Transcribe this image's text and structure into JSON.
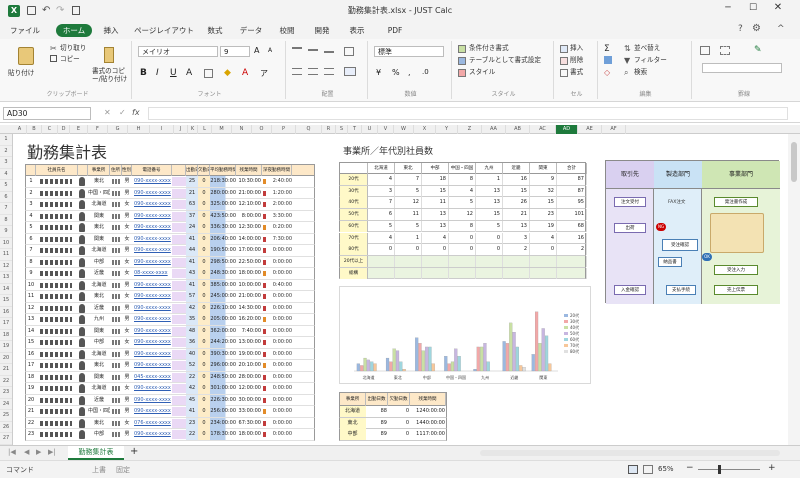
{
  "app": {
    "title": "勤務集計表.xlsx - JUST Calc",
    "brand_color": "#1e7a3c"
  },
  "qat": {
    "icons": [
      "app-logo-icon",
      "save-icon",
      "undo-icon",
      "redo-icon",
      "paste-icon"
    ]
  },
  "tabs": [
    "ファイル",
    "ホーム",
    "挿入",
    "ページレイアウト",
    "数式",
    "データ",
    "校閲",
    "開発",
    "表示",
    "PDF"
  ],
  "ribbon": {
    "clipboard": {
      "paste": "貼り付け",
      "cut": "切り取り",
      "copy": "コピー",
      "format_painter": "書式のコピー/貼り付け",
      "label": "クリップボード"
    },
    "font": {
      "name": "メイリオ",
      "size": "9",
      "label": "フォント"
    },
    "alignment": {
      "label": "配置"
    },
    "number": {
      "format": "標準",
      "label": "数値"
    },
    "styles": {
      "conditional": "条件付き書式",
      "as_table": "テーブルとして書式設定",
      "cell_styles": "スタイル",
      "label": "スタイル"
    },
    "cells": {
      "insert": "挿入",
      "delete": "削除",
      "format": "書式",
      "label": "セル"
    },
    "editing": {
      "sort": "並べ替え",
      "filter": "フィルター",
      "find": "検索",
      "label": "編集"
    },
    "drawing": {
      "label": "罫線"
    }
  },
  "formula_bar": {
    "name_box": "AD30",
    "fx": "fx",
    "value": ""
  },
  "columns": [
    "A",
    "B",
    "C",
    "D",
    "E",
    "F",
    "G",
    "H",
    "I",
    "J",
    "K",
    "L",
    "M",
    "N",
    "O",
    "P",
    "Q",
    "R",
    "S",
    "T",
    "U",
    "V",
    "W",
    "X",
    "Y",
    "Z",
    "AA",
    "AB",
    "AC",
    "AD",
    "AE",
    "AF"
  ],
  "rows": [
    "1",
    "2",
    "3",
    "4",
    "5",
    "6",
    "7",
    "8",
    "9",
    "10",
    "11",
    "12",
    "13",
    "14",
    "15",
    "16",
    "17",
    "18",
    "19",
    "20",
    "21",
    "22",
    "23",
    "24",
    "25",
    "26",
    "27"
  ],
  "sheet": {
    "main_title": "勤務集計表",
    "table_headers": [
      "社員氏名",
      "事業所",
      "住所",
      "性別",
      "電話番号",
      "出勤日数",
      "欠勤日数",
      "平均勤務時間",
      "残業時間",
      "深夜勤務時間"
    ],
    "employees": [
      {
        "no": "1",
        "office": "東北",
        "gender": "男",
        "tel": "090-xxxx-xxxx",
        "days": "25",
        "absent": "0",
        "avg": "218:30:00",
        "over": "10:30:00",
        "night": "2:40:00"
      },
      {
        "no": "2",
        "office": "中国・四国",
        "gender": "男",
        "tel": "090-xxxx-xxxx",
        "days": "21",
        "absent": "0",
        "avg": "280:00:00",
        "over": "21:00:00",
        "night": "1:20:00"
      },
      {
        "no": "3",
        "office": "北海道",
        "gender": "女",
        "tel": "090-xxxx-xxxx",
        "days": "63",
        "absent": "0",
        "avg": "325:00:00",
        "over": "12:10:00",
        "night": "2:00:00"
      },
      {
        "no": "4",
        "office": "関東",
        "gender": "男",
        "tel": "090-xxxx-xxxx",
        "days": "37",
        "absent": "0",
        "avg": "423:50:00",
        "over": "8:00:00",
        "night": "3:30:00"
      },
      {
        "no": "5",
        "office": "東北",
        "gender": "女",
        "tel": "090-xxxx-xxxx",
        "days": "24",
        "absent": "0",
        "avg": "336:30:00",
        "over": "12:30:00",
        "night": "0:20:00"
      },
      {
        "no": "6",
        "office": "関東",
        "gender": "女",
        "tel": "090-xxxx-xxxx",
        "days": "41",
        "absent": "0",
        "avg": "206:40:00",
        "over": "14:00:00",
        "night": "7:30:00"
      },
      {
        "no": "7",
        "office": "北海道",
        "gender": "男",
        "tel": "090-xxxx-xxxx",
        "days": "44",
        "absent": "0",
        "avg": "190:50:00",
        "over": "17:00:00",
        "night": "0:00:00"
      },
      {
        "no": "8",
        "office": "中部",
        "gender": "女",
        "tel": "090-xxxx-xxxx",
        "days": "41",
        "absent": "0",
        "avg": "298:50:00",
        "over": "22:50:00",
        "night": "0:00:00"
      },
      {
        "no": "9",
        "office": "近畿",
        "gender": "女",
        "tel": "08-xxxx-xxxx",
        "days": "43",
        "absent": "0",
        "avg": "248:30:00",
        "over": "18:00:00",
        "night": "0:00:00"
      },
      {
        "no": "10",
        "office": "北海道",
        "gender": "男",
        "tel": "090-xxxx-xxxx",
        "days": "41",
        "absent": "0",
        "avg": "385:00:00",
        "over": "10:00:00",
        "night": "0:40:00"
      },
      {
        "no": "11",
        "office": "東北",
        "gender": "女",
        "tel": "090-xxxx-xxxx",
        "days": "57",
        "absent": "0",
        "avg": "245:00:00",
        "over": "21:00:00",
        "night": "0:00:00"
      },
      {
        "no": "12",
        "office": "近畿",
        "gender": "男",
        "tel": "090-xxxx-xxxx",
        "days": "42",
        "absent": "0",
        "avg": "226:10:00",
        "over": "14:30:00",
        "night": "0:00:00"
      },
      {
        "no": "13",
        "office": "九州",
        "gender": "男",
        "tel": "090-xxxx-xxxx",
        "days": "35",
        "absent": "0",
        "avg": "205:00:00",
        "over": "16:20:00",
        "night": "0:00:00"
      },
      {
        "no": "14",
        "office": "関東",
        "gender": "女",
        "tel": "090-xxxx-xxxx",
        "days": "48",
        "absent": "0",
        "avg": "362:00:00",
        "over": "7:40:00",
        "night": "0:00:00"
      },
      {
        "no": "15",
        "office": "中部",
        "gender": "女",
        "tel": "090-xxxx-xxxx",
        "days": "36",
        "absent": "0",
        "avg": "244:20:00",
        "over": "13:00:00",
        "night": "0:00:00"
      },
      {
        "no": "16",
        "office": "北海道",
        "gender": "男",
        "tel": "090-xxxx-xxxx",
        "days": "40",
        "absent": "0",
        "avg": "390:30:00",
        "over": "19:00:00",
        "night": "0:00:00"
      },
      {
        "no": "17",
        "office": "東北",
        "gender": "男",
        "tel": "090-xxxx-xxxx",
        "days": "52",
        "absent": "0",
        "avg": "296:00:00",
        "over": "20:10:00",
        "night": "0:00:00"
      },
      {
        "no": "18",
        "office": "関東",
        "gender": "男",
        "tel": "045-xxxx-xxxx",
        "days": "22",
        "absent": "0",
        "avg": "248:50:00",
        "over": "28:00:00",
        "night": "0:00:00"
      },
      {
        "no": "19",
        "office": "北海道",
        "gender": "女",
        "tel": "090-xxxx-xxxx",
        "days": "42",
        "absent": "0",
        "avg": "301:00:00",
        "over": "12:00:00",
        "night": "0:00:00"
      },
      {
        "no": "20",
        "office": "近畿",
        "gender": "男",
        "tel": "090-xxxx-xxxx",
        "days": "45",
        "absent": "0",
        "avg": "226:30:00",
        "over": "30:00:00",
        "night": "0:00:00"
      },
      {
        "no": "21",
        "office": "中国・四国",
        "gender": "男",
        "tel": "090-xxxx-xxxx",
        "days": "41",
        "absent": "0",
        "avg": "256:00:00",
        "over": "33:00:00",
        "night": "0:00:00"
      },
      {
        "no": "22",
        "office": "東北",
        "gender": "女",
        "tel": "076-xxxx-xxxx",
        "days": "23",
        "absent": "0",
        "avg": "234:00:00",
        "over": "67:30:00",
        "night": "0:00:00"
      },
      {
        "no": "23",
        "office": "中部",
        "gender": "男",
        "tel": "090-xxxx-xxxx",
        "days": "22",
        "absent": "0",
        "avg": "178:30:00",
        "over": "18:00:00",
        "night": "0:00:00"
      }
    ],
    "age_table": {
      "title": "事業所／年代別社員数",
      "headers": [
        "北海道",
        "東北",
        "中部",
        "中国・四国",
        "九州",
        "近畿",
        "関東",
        "合計"
      ],
      "rows": [
        {
          "label": "20代",
          "values": [
            "4",
            "7",
            "18",
            "8",
            "1",
            "16",
            "9",
            "87"
          ]
        },
        {
          "label": "30代",
          "values": [
            "3",
            "5",
            "15",
            "4",
            "13",
            "15",
            "32",
            "87"
          ]
        },
        {
          "label": "40代",
          "values": [
            "7",
            "12",
            "11",
            "5",
            "13",
            "26",
            "15",
            "95"
          ]
        },
        {
          "label": "50代",
          "values": [
            "6",
            "11",
            "13",
            "12",
            "15",
            "21",
            "23",
            "101"
          ]
        },
        {
          "label": "60代",
          "values": [
            "5",
            "5",
            "13",
            "8",
            "5",
            "13",
            "19",
            "68"
          ]
        },
        {
          "label": "70代",
          "values": [
            "4",
            "1",
            "4",
            "0",
            "0",
            "3",
            "4",
            "16"
          ]
        },
        {
          "label": "80代",
          "values": [
            "0",
            "0",
            "0",
            "0",
            "0",
            "2",
            "0",
            "2"
          ]
        },
        {
          "label": "20代以上",
          "values": [
            "",
            "",
            "",
            "",
            "",
            "",
            "",
            ""
          ]
        },
        {
          "label": "総構",
          "values": [
            "",
            "",
            "",
            "",
            "",
            "",
            "",
            ""
          ]
        }
      ]
    },
    "bottom_table": {
      "headers": [
        "事業所",
        "出勤日数",
        "欠勤日数",
        "残業時間"
      ],
      "rows": [
        [
          "北海道",
          "88",
          "0",
          "1240:00:00"
        ],
        [
          "東北",
          "89",
          "0",
          "1440:00:00"
        ],
        [
          "中部",
          "89",
          "0",
          "1117:00:00"
        ]
      ]
    },
    "flowchart": {
      "lanes": [
        "取引先",
        "製造部門",
        "事業部門"
      ],
      "boxes": [
        "注文受付",
        "出荷",
        "入金確認",
        "受注確認",
        "FAX注文",
        "発注書作成",
        "受注入力",
        "売上伝票",
        "納品書",
        "支払手続"
      ],
      "tags": [
        "NG",
        "OK"
      ]
    }
  },
  "chart_data": {
    "type": "bar",
    "categories": [
      "北海道",
      "東北",
      "中部",
      "中国・四国",
      "九州",
      "近畿",
      "関東"
    ],
    "series": [
      {
        "name": "20代",
        "values": [
          4,
          7,
          18,
          8,
          1,
          16,
          9
        ]
      },
      {
        "name": "30代",
        "values": [
          3,
          5,
          15,
          4,
          13,
          15,
          32
        ]
      },
      {
        "name": "40代",
        "values": [
          7,
          12,
          11,
          5,
          13,
          26,
          15
        ]
      },
      {
        "name": "50代",
        "values": [
          6,
          11,
          13,
          12,
          15,
          21,
          23
        ]
      },
      {
        "name": "60代",
        "values": [
          5,
          5,
          13,
          8,
          5,
          13,
          19
        ]
      },
      {
        "name": "70代",
        "values": [
          4,
          1,
          4,
          0,
          0,
          3,
          4
        ]
      },
      {
        "name": "80代",
        "values": [
          0,
          0,
          0,
          0,
          0,
          2,
          0
        ]
      }
    ],
    "colors": [
      "#9bb8e0",
      "#f2a8a8",
      "#c9e0a4",
      "#c7b6e0",
      "#9fd6de",
      "#f7c79a",
      "#e0e0e0"
    ],
    "ylim": [
      0,
      40
    ],
    "legend": "right",
    "grid": false
  },
  "sheet_tabs": {
    "active": "勤務集計表",
    "add": "+"
  },
  "status": {
    "mode": "コマンド",
    "overwrite": "上書",
    "fixed": "固定",
    "zoom": "65%"
  }
}
